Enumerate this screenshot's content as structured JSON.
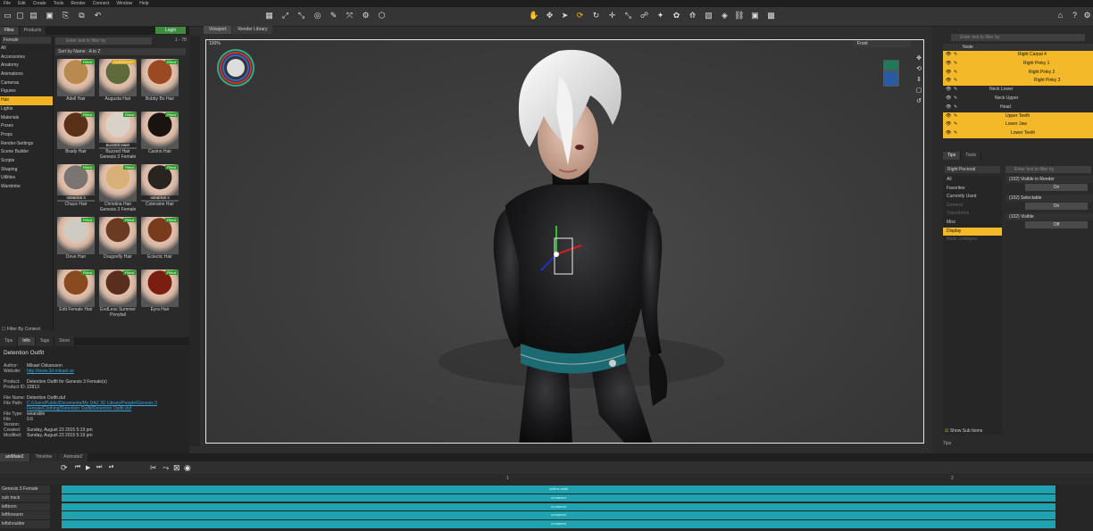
{
  "menu": [
    "File",
    "Edit",
    "Create",
    "Tools",
    "Render",
    "Connect",
    "Window",
    "Help"
  ],
  "left_panel": {
    "tabs": [
      {
        "label": "Files"
      },
      {
        "label": "Products"
      }
    ],
    "login": "Login",
    "figure_dropdown": "Female",
    "filter_placeholder": "Enter text to filter by",
    "filter_count": "1 - 78",
    "sort": "Sort by Name : A to Z",
    "categories": [
      "All",
      "Accessories",
      "Anatomy",
      "Animations",
      "Cameras",
      "Figures",
      "Hair",
      "Lights",
      "Materials",
      "Poses",
      "Props",
      "Render-Settings",
      "Scene Builder",
      "Scripts",
      "Shaping",
      "Utilities",
      "Wardrobe"
    ],
    "selected_category": "Hair",
    "items": [
      {
        "label": "Adell Hair",
        "badge": "Fitted",
        "color": "#b98a50"
      },
      {
        "label": "Augusta Hair",
        "badge": "SUPERSUIT",
        "color": "#5e6a3a"
      },
      {
        "label": "Bobby Bo Hair",
        "badge": "Fitted",
        "color": "#9a4a22"
      },
      {
        "label": "Brady Hair",
        "badge": "Fitted",
        "color": "#5a3018"
      },
      {
        "label": "Buzzed Hair Genesis 3 Female",
        "badge": "Fitted",
        "overlay": "BUZZED HAIR",
        "color": "#d8d2c8"
      },
      {
        "label": "Casino Hair",
        "badge": "Fitted",
        "color": "#1a1410"
      },
      {
        "label": "Chace Hair",
        "badge": "Fitted",
        "overlay": "GENESIS 3",
        "color": "#7a7570"
      },
      {
        "label": "Christina Hair Genesis 3 Female",
        "badge": "Fitted",
        "color": "#d8b078"
      },
      {
        "label": "Coleraine Hair",
        "badge": "Fitted",
        "overlay": "GENESIS 3",
        "color": "#2a2420"
      },
      {
        "label": "Dove Hair",
        "badge": "Fitted",
        "color": "#cfcac2"
      },
      {
        "label": "Dragonfly Hair",
        "badge": "Fitted",
        "color": "#6a3a22"
      },
      {
        "label": "Eclectic Hair",
        "badge": "Fitted",
        "color": "#7a3a1e"
      },
      {
        "label": "Edit Female Hair",
        "badge": "Fitted",
        "color": "#8a4a20"
      },
      {
        "label": "EndLess Summer Ponytail",
        "badge": "Fitted",
        "color": "#5a2e1e"
      },
      {
        "label": "Eyra Hair",
        "badge": "Fitted",
        "color": "#7a1e12"
      }
    ],
    "filter_context": "Filter By Context",
    "info_tabs": [
      {
        "label": "Tips"
      },
      {
        "label": "Info"
      },
      {
        "label": "Tags"
      },
      {
        "label": "Store"
      }
    ],
    "info": {
      "title": "Detention Outfit",
      "author_k": "Author:",
      "author_v": "Mikael Oskarsson",
      "website_k": "Website:",
      "website_v": "http://www.3d-mikael.se",
      "product_k": "Product:",
      "product_v": "Detention Outfit for Genesis 3 Female(s)",
      "product_id_k": "Product ID:",
      "product_id_v": "22813",
      "file_k": "File Name:",
      "file_v": "Detention Outfit.duf",
      "path_k": "File Path:",
      "path_v": "C:/Users/Public/Documents/My DAZ 3D Library/People/Genesis 3 Female/Clothing/Detention Outfit/Detention Outfit.duf",
      "type_k": "File Type:",
      "type_v": "wearable",
      "ver_k": "File Version:",
      "ver_v": "0.6",
      "created_k": "Created:",
      "created_v": "Sunday, August 23 2015 5:19 pm",
      "modified_k": "Modified:",
      "modified_v": "Sunday, August 23 2015 5:19 pm"
    }
  },
  "viewport": {
    "tabs": [
      {
        "label": "Viewport"
      },
      {
        "label": "Render Library"
      }
    ],
    "camera": "Front",
    "zoom": "100%"
  },
  "scene": {
    "search_placeholder": "Enter text to filter by",
    "header": "Node",
    "nodes": [
      {
        "name": "Right Carpal 4",
        "indent": 84,
        "sel": true
      },
      {
        "name": "Right Pinky 1",
        "indent": 90,
        "sel": true
      },
      {
        "name": "Right Pinky 2",
        "indent": 96,
        "sel": true
      },
      {
        "name": "Right Pinky 3",
        "indent": 102,
        "sel": true
      },
      {
        "name": "Neck Lower",
        "indent": 52,
        "sel": false
      },
      {
        "name": "Neck Upper",
        "indent": 58,
        "sel": false
      },
      {
        "name": "Head",
        "indent": 64,
        "sel": false
      },
      {
        "name": "Upper Teeth",
        "indent": 70,
        "sel": true
      },
      {
        "name": "Lower Jaw",
        "indent": 70,
        "sel": true
      },
      {
        "name": "Lower Teeth",
        "indent": 76,
        "sel": true
      }
    ]
  },
  "params": {
    "tabs": [
      {
        "label": "Tips"
      },
      {
        "label": "Tools"
      }
    ],
    "dropdown": "Right Pectoral",
    "search_placeholder": "Enter text to filter by",
    "tree": [
      {
        "label": "All",
        "sel": false,
        "dim": false
      },
      {
        "label": "Favorites",
        "sel": false,
        "dim": false
      },
      {
        "label": "Currently Used",
        "sel": false,
        "dim": false
      },
      {
        "label": "General",
        "sel": false,
        "dim": true
      },
      {
        "label": "Transforms",
        "sel": false,
        "dim": true
      },
      {
        "label": "Misc",
        "sel": false,
        "dim": false
      },
      {
        "label": "Display",
        "sel": true,
        "dim": false
      },
      {
        "label": "Node Limbsync",
        "sel": false,
        "dim": true
      }
    ],
    "props": [
      {
        "name": "(102) Visible in Render",
        "value": "On"
      },
      {
        "name": "(102) Selectable",
        "value": "On"
      },
      {
        "name": "(102) Visible",
        "value": "Off"
      }
    ],
    "show_sub": "Show Sub Items",
    "tips": "Tips"
  },
  "timeline": {
    "tabs": [
      {
        "label": "aniMate2"
      },
      {
        "label": "Timeline"
      },
      {
        "label": "Animate2"
      }
    ],
    "tracks": [
      {
        "name": "Genesis 3 Female",
        "bar": "outline-walk"
      },
      {
        "name": "sub track",
        "bar": "unnamed"
      },
      {
        "name": "lefttorm",
        "bar": "unnamed"
      },
      {
        "name": "leftforearm",
        "bar": "unnamed"
      },
      {
        "name": "leftshoulder",
        "bar": "unnamed"
      }
    ],
    "ruler_mark_1": "1",
    "ruler_mark_2": "2"
  },
  "colors": {
    "accent": "#f3b928",
    "track": "#1fa3b0",
    "badge": "#2a9a2a"
  }
}
